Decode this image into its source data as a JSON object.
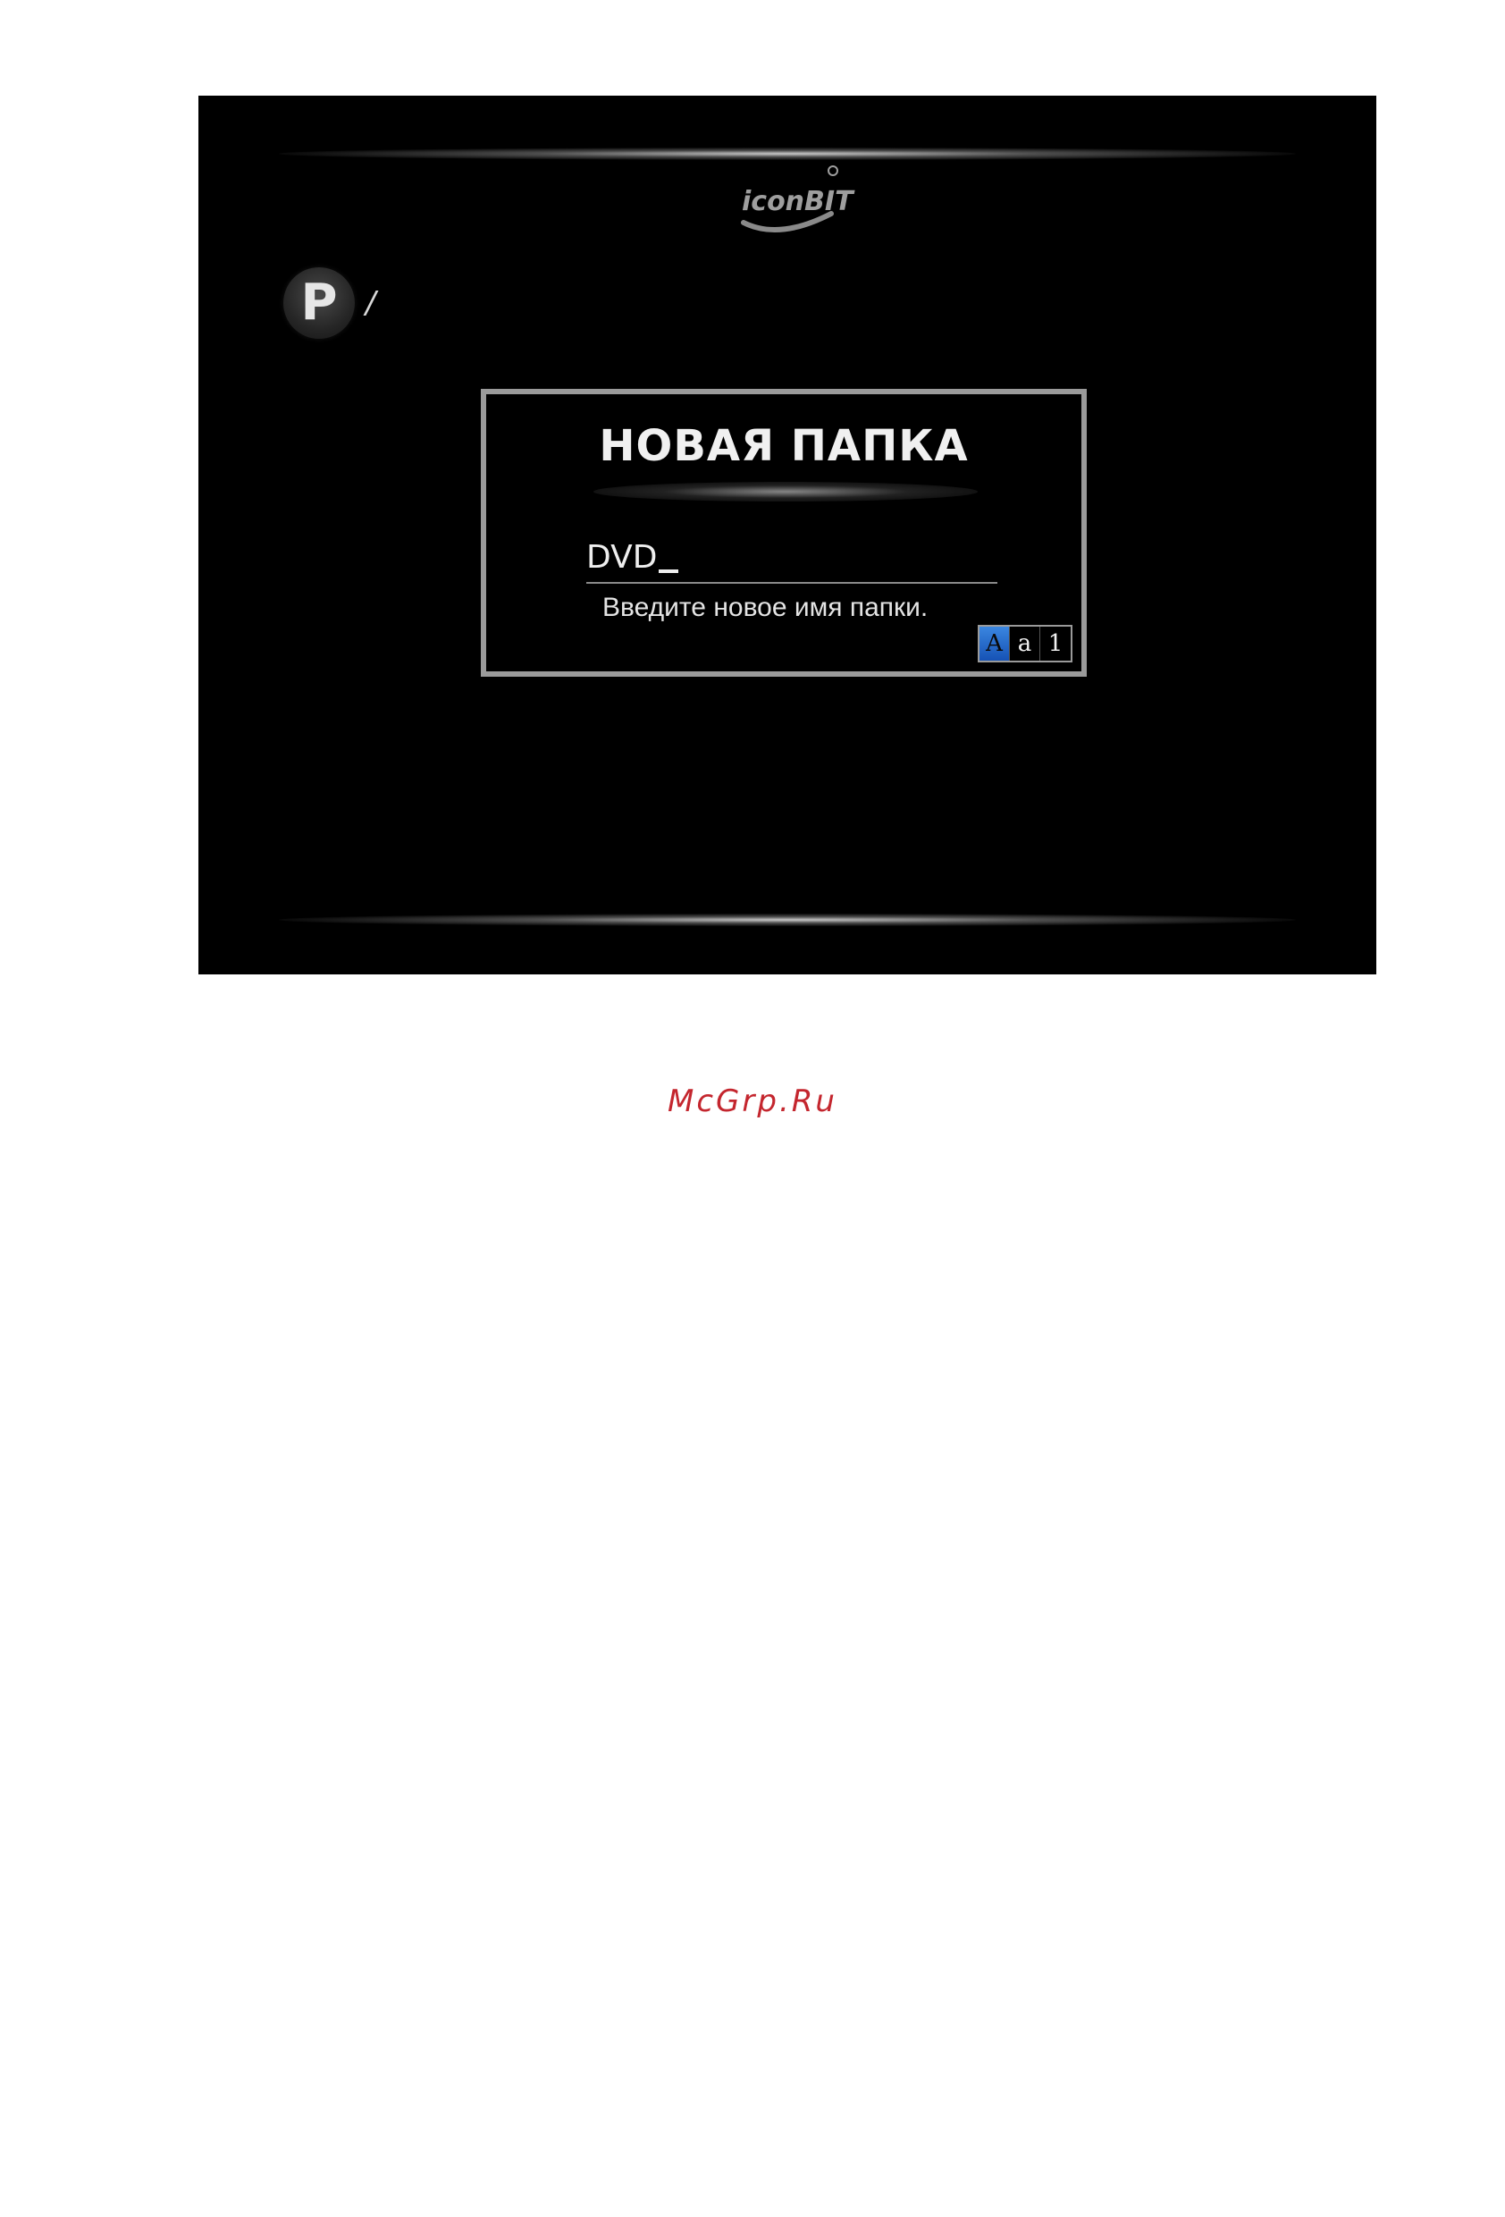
{
  "screen": {
    "brand_logo": "iconBIT",
    "breadcrumb": {
      "drive_icon_letter": "P",
      "path": "/"
    },
    "dialog": {
      "title": "НОВАЯ ПАПКА",
      "input_value": "DVD",
      "hint": "Введите новое имя папки.",
      "input_modes": [
        {
          "label": "A",
          "active": true
        },
        {
          "label": "a",
          "active": false
        },
        {
          "label": "1",
          "active": false
        }
      ]
    }
  },
  "watermark": "McGrp.Ru",
  "colors": {
    "background": "#000000",
    "dialog_border": "#9a9a9a",
    "active_mode": "#1f6fd6",
    "watermark": "#c4262e"
  }
}
